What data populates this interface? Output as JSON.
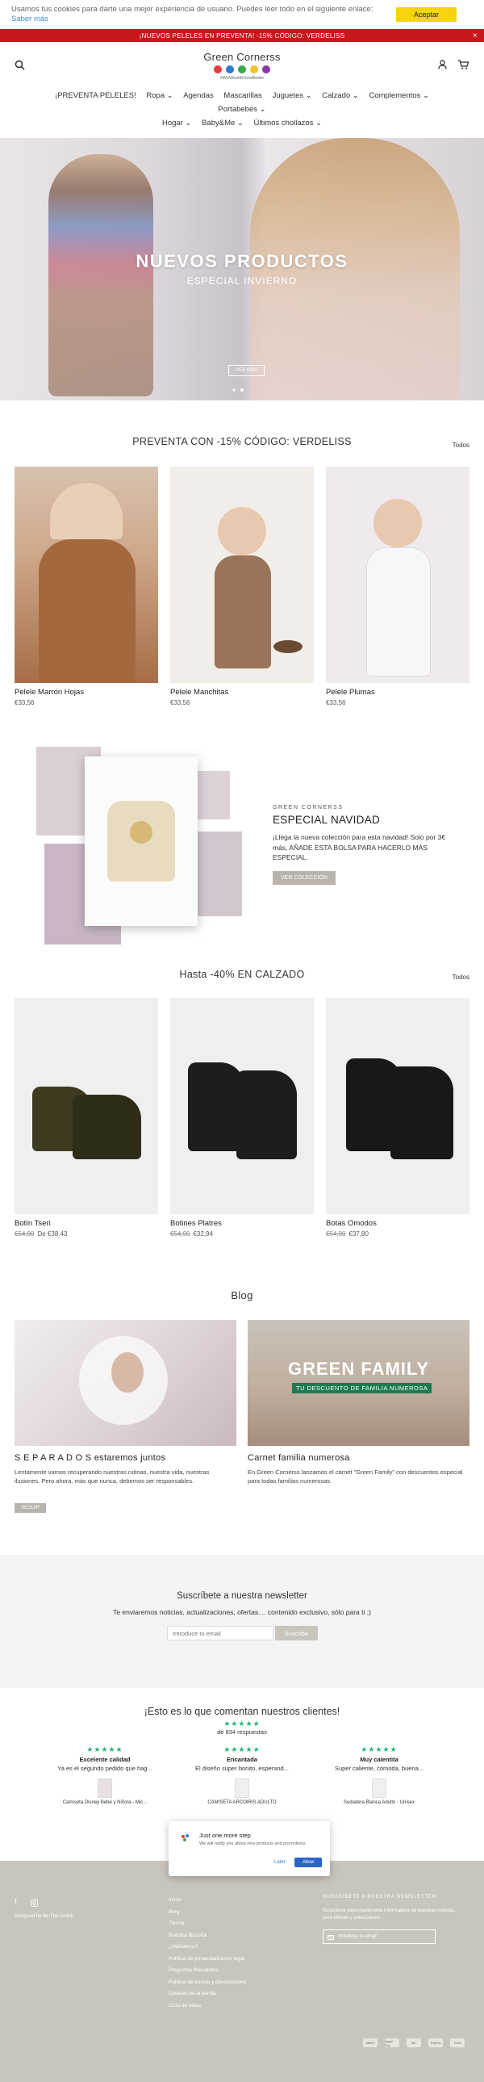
{
  "cookie": {
    "text": "Usamos tus cookies para darte una mejor experiencia de usuario. Puedes leer todo en el siguiente enlace:",
    "link": "Saber más",
    "accept": "Aceptar"
  },
  "announcement": {
    "text": "¡NUEVOS PELELES EN PREVENTA! -15% CÓDIGO: VERDELISS",
    "close": "×"
  },
  "header": {
    "logo_name": "Green Cornerss",
    "logo_tag": "#WeWouldGrowBetter"
  },
  "colors": {
    "announce": "#c8161d",
    "accept": "#f5d40e",
    "footer": "#c9c5bc",
    "stars": "#22b573",
    "button_grey": "#b8b4ad"
  },
  "icons": {
    "search": "search-icon",
    "account": "user-icon",
    "cart": "cart-icon"
  },
  "nav": {
    "row1": [
      "¡PREVENTA PELELES!",
      "Ropa ⌄",
      "Agendas",
      "Mascarillas",
      "Juguetes ⌄",
      "Calzado ⌄",
      "Complementos ⌄",
      "Portabebés ⌄"
    ],
    "row2": [
      "Hogar ⌄",
      "Baby&Me ⌄",
      "Últimos chollazos ⌄"
    ]
  },
  "hero": {
    "title": "NUEVOS PRODUCTOS",
    "subtitle": "ESPECIAL INVIERNO",
    "button": "VER MÁS"
  },
  "preventa": {
    "title": "PREVENTA CON -15% CÓDIGO: VERDELISS",
    "all": "Todos",
    "products": [
      {
        "name": "Pelele Marrón Hojas",
        "price": "€33,56"
      },
      {
        "name": "Pelele Manchitas",
        "price": "€33,56"
      },
      {
        "name": "Pelele Plumas",
        "price": "€33,56"
      }
    ]
  },
  "promo": {
    "eyebrow": "GREEN CORNERSS",
    "title": "ESPECIAL NAVIDAD",
    "text": "¡Llega la nueva colección para esta navidad! Solo por 3€ más, AÑADE ESTA BOLSA PARA HACERLO MÁS ESPECIAL.",
    "button": "VER COLECCIÓN"
  },
  "calzado": {
    "title": "Hasta -40% EN CALZADO",
    "all": "Todos",
    "products": [
      {
        "name": "Botín Tseri",
        "old": "€54,90",
        "price": "De €38,43"
      },
      {
        "name": "Botines Platres",
        "old": "€54,90",
        "price": "€32,94"
      },
      {
        "name": "Botas Omodos",
        "old": "€54,90",
        "price": "€37,80"
      }
    ]
  },
  "blog": {
    "title": "Blog",
    "posts": [
      {
        "title": "S E P A R A D O S estaremos juntos",
        "text": "Lentamente vamos recuperando nuestras rutinas, nuestra vida, nuestras ilusiones. Pero ahora, más que nunca, debemos ser responsables.",
        "button": "SEGUIR"
      },
      {
        "title": "Carnet familia numerosa",
        "text": "En Green Cornerss lanzamos el carnet \"Green Family\" con descuentos especial para todas familias numerosas.",
        "banner1": "GREEN FAMILY",
        "banner2": "TU DESCUENTO DE FAMILIA NUMEROSA"
      }
    ]
  },
  "newsletter": {
    "title": "Suscríbete a nuestra newsletter",
    "text": "Te enviaremos noticias, actualizaciones, ofertas.... contenido exclusivo, sólo para ti ;)",
    "placeholder": "Introduce tu email",
    "button": "Suscribir"
  },
  "reviews": {
    "title": "¡Esto es lo que comentan nuestros clientes!",
    "stars": "★★★★★",
    "count": "de 834 respuestas",
    "items": [
      {
        "stars": "★★★★★",
        "label": "Excelente calidad",
        "text": "Ya es el segundo pedido que hag...",
        "product": "Camiseta Disney Bebé y Niño/a - Mic..."
      },
      {
        "stars": "★★★★★",
        "label": "Encantada",
        "text": "El diseño super bonito, esperand...",
        "product": "CAMISETA ARCOIRIS ADULTO"
      },
      {
        "stars": "★★★★★",
        "label": "Muy calentita",
        "text": "Super caliente, cómoda, buena...",
        "product": "Sudadera Blanca Adulto - Unisex"
      }
    ]
  },
  "popup": {
    "title": "Just one more step",
    "text": "We will notify you about new products and promotions.",
    "later": "Later",
    "allow": "Allow"
  },
  "footer": {
    "designed": "Designed by Be The Coach",
    "links": [
      "Inicio",
      "Blog",
      "Tienda",
      "Nuestra filosofía",
      "¿Hablamos?",
      "Política de privacidad/aviso legal",
      "Preguntas frecuentes",
      "Política de envíos y devoluciones",
      "Cookies de la tienda",
      "Guía de tallas"
    ],
    "newsletter_title": "SUSCRÍBETE A NUESTRA NEWSLETTER",
    "newsletter_text": "Suscríbete para mantenerte informado/a de nuestras noticias, pero ofertas y colecciones.",
    "newsletter_placeholder": "Introduce tu email",
    "payments": [
      "AMEX",
      "Apple Pay",
      "MC",
      "PayPal",
      "VISA"
    ]
  }
}
